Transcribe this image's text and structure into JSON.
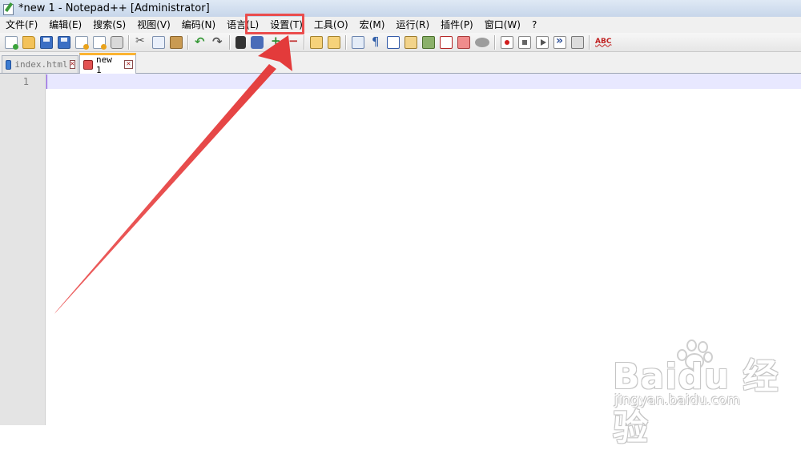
{
  "window": {
    "title": "*new 1 - Notepad++ [Administrator]"
  },
  "menu": {
    "items": [
      "文件(F)",
      "编辑(E)",
      "搜索(S)",
      "视图(V)",
      "编码(N)",
      "语言(L)",
      "设置(T)",
      "工具(O)",
      "宏(M)",
      "运行(R)",
      "插件(P)",
      "窗口(W)",
      "?"
    ]
  },
  "tabs": [
    {
      "label": "index.html",
      "active": false
    },
    {
      "label": "new 1",
      "active": true
    }
  ],
  "editor": {
    "line_numbers": [
      "1"
    ]
  },
  "annotation": {
    "highlighted_menu": "设置(T)",
    "color": "#ea4d4d"
  },
  "watermark": {
    "logo": "Baidu",
    "logo_suffix": "经验",
    "site": "jingyan.baidu.com"
  }
}
